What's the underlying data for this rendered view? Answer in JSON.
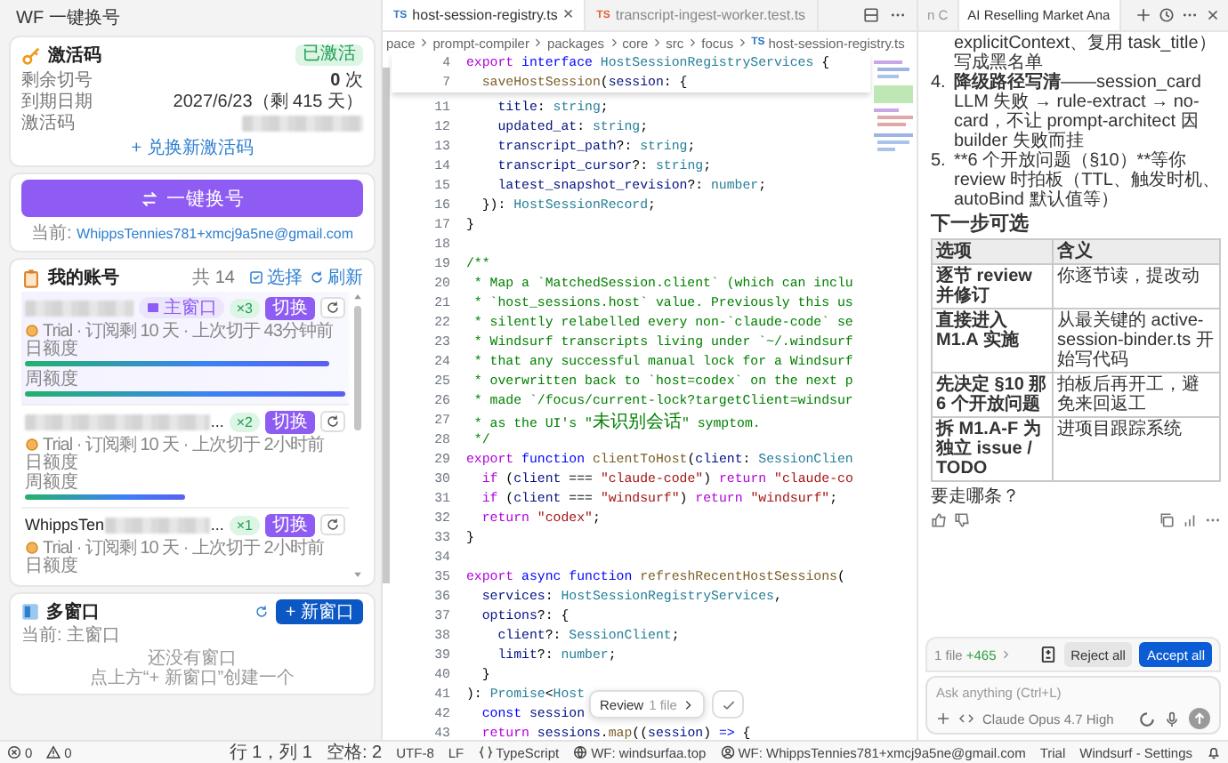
{
  "panel": {
    "title": "WF 一键换号",
    "activation": {
      "title": "激活码",
      "badge": "已激活",
      "rows": [
        {
          "kind": "count",
          "label": "剩余切号",
          "value": "0",
          "unit": "次"
        },
        {
          "kind": "text",
          "label": "到期日期",
          "value": "2027/6/23（剩 415 天）"
        },
        {
          "kind": "redacted",
          "label": "激活码"
        }
      ],
      "link": "+ 兑换新激活码"
    },
    "switcher": {
      "button": "一键换号",
      "current_label": "当前:",
      "current_email": "WhippsTennies781+xmcj9a5ne@gmail.com"
    },
    "accounts": {
      "title": "我的账号",
      "count": "共 14",
      "select": "选择",
      "refresh": "刷新",
      "items": [
        {
          "selected": true,
          "window": "主窗口",
          "uses": "×3",
          "switch": "切换",
          "meta": "Trial · 订阅剩 10 天 · 上次切于 43分钟前",
          "quotas": [
            {
              "label": "日额度",
              "level": 0.95
            },
            {
              "label": "周额度",
              "level": 1
            }
          ]
        },
        {
          "selected": false,
          "name_suffix": "...",
          "uses": "×2",
          "switch": "切换",
          "meta": "Trial · 订阅剩 10 天 · 上次切于 2小时前",
          "quotas": [
            {
              "label": "日额度"
            },
            {
              "label": "周额度",
              "level": 0.5
            }
          ]
        },
        {
          "selected": false,
          "name_prefix": "WhippsTen",
          "name_suffix": "...",
          "uses": "×1",
          "switch": "切换",
          "meta": "Trial · 订阅剩 10 天 · 上次切于 2小时前",
          "quotas": [
            {
              "label": "日额度"
            }
          ]
        }
      ]
    },
    "windows": {
      "title": "多窗口",
      "new_button": "+ 新窗口",
      "current": "当前: 主窗口",
      "empty_title": "还没有窗口",
      "empty_hint": "点上方“+ 新窗口”创建一个"
    }
  },
  "editor": {
    "tabs": [
      {
        "kind": "source",
        "badge": "TS",
        "label": "host-session-registry.ts",
        "selected": true,
        "close": "×"
      },
      {
        "kind": "test",
        "badge": "TS",
        "label": "transcript-ingest-worker.test.ts",
        "selected": false
      }
    ],
    "breadcrumb": [
      {
        "label": "pace"
      },
      {
        "label": "prompt-compiler"
      },
      {
        "label": "packages"
      },
      {
        "label": "core"
      },
      {
        "label": "src"
      },
      {
        "label": "focus"
      },
      {
        "label": "host-session-registry.ts",
        "badge": "TS"
      }
    ],
    "sticky_lines": [
      {
        "n": "4",
        "code": [
          {
            "kind": "c",
            "text": "export "
          },
          {
            "kind": "k",
            "text": "interface "
          },
          {
            "kind": "t",
            "text": "HostSessionRegistryServices"
          },
          {
            "kind": "p",
            "text": " {"
          }
        ]
      },
      {
        "n": "7",
        "code": [
          {
            "kind": "f",
            "text": "  saveHostSession"
          },
          {
            "kind": "p",
            "text": "("
          },
          {
            "kind": "v",
            "text": "session"
          },
          {
            "kind": "p",
            "text": ": {"
          }
        ]
      }
    ],
    "lines": [
      {
        "n": "11",
        "code": [
          {
            "kind": "v",
            "text": "    title"
          },
          {
            "kind": "p",
            "text": ": "
          },
          {
            "kind": "t",
            "text": "string"
          },
          {
            "kind": "p",
            "text": ";"
          }
        ]
      },
      {
        "n": "12",
        "code": [
          {
            "kind": "v",
            "text": "    updated_at"
          },
          {
            "kind": "p",
            "text": ": "
          },
          {
            "kind": "t",
            "text": "string"
          },
          {
            "kind": "p",
            "text": ";"
          }
        ]
      },
      {
        "n": "13",
        "code": [
          {
            "kind": "v",
            "text": "    transcript_path"
          },
          {
            "kind": "p",
            "text": "?: "
          },
          {
            "kind": "t",
            "text": "string"
          },
          {
            "kind": "p",
            "text": ";"
          }
        ]
      },
      {
        "n": "14",
        "code": [
          {
            "kind": "v",
            "text": "    transcript_cursor"
          },
          {
            "kind": "p",
            "text": "?: "
          },
          {
            "kind": "t",
            "text": "string"
          },
          {
            "kind": "p",
            "text": ";"
          }
        ]
      },
      {
        "n": "15",
        "code": [
          {
            "kind": "v",
            "text": "    latest_snapshot_revision"
          },
          {
            "kind": "p",
            "text": "?: "
          },
          {
            "kind": "t",
            "text": "number"
          },
          {
            "kind": "p",
            "text": ";"
          }
        ]
      },
      {
        "n": "16",
        "code": [
          {
            "kind": "p",
            "text": "  }): "
          },
          {
            "kind": "t",
            "text": "HostSessionRecord"
          },
          {
            "kind": "p",
            "text": ";"
          }
        ]
      },
      {
        "n": "17",
        "code": [
          {
            "kind": "p",
            "text": "}"
          }
        ]
      },
      {
        "n": "18"
      },
      {
        "n": "19",
        "code": [
          {
            "kind": "m",
            "text": "/**"
          }
        ]
      },
      {
        "n": "20",
        "code": [
          {
            "kind": "m",
            "text": " * Map a `MatchedSession.client` (which can inclu"
          }
        ]
      },
      {
        "n": "21",
        "code": [
          {
            "kind": "m",
            "text": " * `host_sessions.host` value. Previously this us"
          }
        ]
      },
      {
        "n": "22",
        "code": [
          {
            "kind": "m",
            "text": " * silently relabelled every non-`claude-code` se"
          }
        ]
      },
      {
        "n": "23",
        "code": [
          {
            "kind": "m",
            "text": " * Windsurf transcripts living under `~/.windsurf"
          }
        ]
      },
      {
        "n": "24",
        "code": [
          {
            "kind": "m",
            "text": " * that any successful manual lock for a Windsurf"
          }
        ]
      },
      {
        "n": "25",
        "code": [
          {
            "kind": "m",
            "text": " * overwritten back to `host=codex` on the next p"
          }
        ]
      },
      {
        "n": "26",
        "code": [
          {
            "kind": "m",
            "text": " * made `/focus/current-lock?targetClient=windsur"
          }
        ]
      },
      {
        "n": "27",
        "code": [
          {
            "kind": "m",
            "text": " * as the UI's \""
          },
          {
            "kind": "z",
            "text": "未识别会话"
          },
          {
            "kind": "m",
            "text": "\" symptom."
          }
        ]
      },
      {
        "n": "28",
        "code": [
          {
            "kind": "m",
            "text": " */"
          }
        ]
      },
      {
        "n": "29",
        "code": [
          {
            "kind": "c",
            "text": "export "
          },
          {
            "kind": "k",
            "text": "function "
          },
          {
            "kind": "f",
            "text": "clientToHost"
          },
          {
            "kind": "p",
            "text": "("
          },
          {
            "kind": "v",
            "text": "client"
          },
          {
            "kind": "p",
            "text": ": "
          },
          {
            "kind": "t",
            "text": "SessionClien"
          }
        ]
      },
      {
        "n": "30",
        "code": [
          {
            "kind": "c",
            "text": "  if"
          },
          {
            "kind": "p",
            "text": " ("
          },
          {
            "kind": "v",
            "text": "client"
          },
          {
            "kind": "p",
            "text": " === "
          },
          {
            "kind": "s",
            "text": "\"claude-code\""
          },
          {
            "kind": "p",
            "text": ") "
          },
          {
            "kind": "c",
            "text": "return "
          },
          {
            "kind": "s",
            "text": "\"claude-co"
          }
        ]
      },
      {
        "n": "31",
        "code": [
          {
            "kind": "c",
            "text": "  if"
          },
          {
            "kind": "p",
            "text": " ("
          },
          {
            "kind": "v",
            "text": "client"
          },
          {
            "kind": "p",
            "text": " === "
          },
          {
            "kind": "s",
            "text": "\"windsurf\""
          },
          {
            "kind": "p",
            "text": ") "
          },
          {
            "kind": "c",
            "text": "return "
          },
          {
            "kind": "s",
            "text": "\"windsurf\""
          },
          {
            "kind": "p",
            "text": ";"
          }
        ]
      },
      {
        "n": "32",
        "code": [
          {
            "kind": "c",
            "text": "  return "
          },
          {
            "kind": "s",
            "text": "\"codex\""
          },
          {
            "kind": "p",
            "text": ";"
          }
        ]
      },
      {
        "n": "33",
        "code": [
          {
            "kind": "p",
            "text": "}"
          }
        ]
      },
      {
        "n": "34"
      },
      {
        "n": "35",
        "code": [
          {
            "kind": "c",
            "text": "export "
          },
          {
            "kind": "k",
            "text": "async "
          },
          {
            "kind": "k",
            "text": "function "
          },
          {
            "kind": "f",
            "text": "refreshRecentHostSessions"
          },
          {
            "kind": "p",
            "text": "("
          }
        ]
      },
      {
        "n": "36",
        "code": [
          {
            "kind": "v",
            "text": "  services"
          },
          {
            "kind": "p",
            "text": ": "
          },
          {
            "kind": "t",
            "text": "HostSessionRegistryServices"
          },
          {
            "kind": "p",
            "text": ","
          }
        ]
      },
      {
        "n": "37",
        "code": [
          {
            "kind": "v",
            "text": "  options"
          },
          {
            "kind": "p",
            "text": "?: {"
          }
        ]
      },
      {
        "n": "38",
        "code": [
          {
            "kind": "v",
            "text": "    client"
          },
          {
            "kind": "p",
            "text": "?: "
          },
          {
            "kind": "t",
            "text": "SessionClient"
          },
          {
            "kind": "p",
            "text": ";"
          }
        ]
      },
      {
        "n": "39",
        "code": [
          {
            "kind": "v",
            "text": "    limit"
          },
          {
            "kind": "p",
            "text": "?: "
          },
          {
            "kind": "t",
            "text": "number"
          },
          {
            "kind": "p",
            "text": ";"
          }
        ]
      },
      {
        "n": "40",
        "code": [
          {
            "kind": "p",
            "text": "  }"
          }
        ]
      },
      {
        "n": "41",
        "code": [
          {
            "kind": "p",
            "text": "): "
          },
          {
            "kind": "t",
            "text": "Promise"
          },
          {
            "kind": "p",
            "text": "<"
          },
          {
            "kind": "t",
            "text": "Host"
          }
        ]
      },
      {
        "n": "42",
        "code": [
          {
            "kind": "k",
            "text": "  const "
          },
          {
            "kind": "v",
            "text": "session"
          }
        ]
      },
      {
        "n": "43",
        "code": [
          {
            "kind": "c",
            "text": "  return "
          },
          {
            "kind": "v",
            "text": "sessions"
          },
          {
            "kind": "p",
            "text": "."
          },
          {
            "kind": "f",
            "text": "map"
          },
          {
            "kind": "p",
            "text": "(("
          },
          {
            "kind": "v",
            "text": "session"
          },
          {
            "kind": "p",
            "text": ") "
          },
          {
            "kind": "k",
            "text": "=>"
          },
          {
            "kind": "p",
            "text": " {"
          }
        ]
      }
    ],
    "review_popover": {
      "label": "Review",
      "detail": "1 file"
    }
  },
  "chat": {
    "tabs": [
      {
        "label": "n C",
        "selected": false
      },
      {
        "label": "AI Reselling Market Ana",
        "selected": true
      }
    ],
    "continuation": "explicitContext、复用 task_title）写成黑名单",
    "items": [
      {
        "number": "4.",
        "bold": "降级路径写清",
        "text": "——session_card LLM 失败 → rule-extract → no-card，不让 prompt-architect 因 builder 失败而挂"
      },
      {
        "number": "5.",
        "text": "**6 个开放问题（§10）**等你 review 时拍板（TTL、触发时机、autoBind 默认值等）"
      }
    ],
    "heading": "下一步可选",
    "table": {
      "columns": [
        "选项",
        "含义"
      ],
      "rows": [
        [
          "逐节 review 并修订",
          "你逐节读，提改动"
        ],
        [
          "直接进入 M1.A 实施",
          "从最关键的 active-session-binder.ts 开始写代码"
        ],
        [
          "先决定 §10 那 6 个开放问题",
          "拍板后再开工，避免来回返工"
        ],
        [
          "拆 M1.A-F 为独立 issue / TODO",
          "进项目跟踪系统"
        ]
      ]
    },
    "question": "要走哪条？",
    "changes": {
      "files": "1 file",
      "added": "+465",
      "reject": "Reject all",
      "accept": "Accept all"
    },
    "input": {
      "placeholder": "Ask anything (Ctrl+L)",
      "model": "Claude Opus 4.7 High"
    }
  },
  "status_bar": {
    "left": [
      {
        "kind": "errors",
        "text": "0"
      },
      {
        "kind": "warnings",
        "text": "0"
      }
    ],
    "right": [
      {
        "kind": "position",
        "text": "行 1，列 1"
      },
      {
        "kind": "indent",
        "text": "空格: 2"
      },
      {
        "kind": "encoding",
        "text": "UTF-8"
      },
      {
        "kind": "eol",
        "text": "LF"
      },
      {
        "kind": "language",
        "text": "TypeScript"
      },
      {
        "kind": "server",
        "text": "WF: windsurfaa.top"
      },
      {
        "kind": "account",
        "text": "WF: WhippsTennies781+xmcj9a5ne@gmail.com"
      },
      {
        "kind": "plan",
        "text": "Trial"
      },
      {
        "kind": "settings",
        "text": "Windsurf - Settings"
      },
      {
        "kind": "notifications"
      }
    ]
  }
}
